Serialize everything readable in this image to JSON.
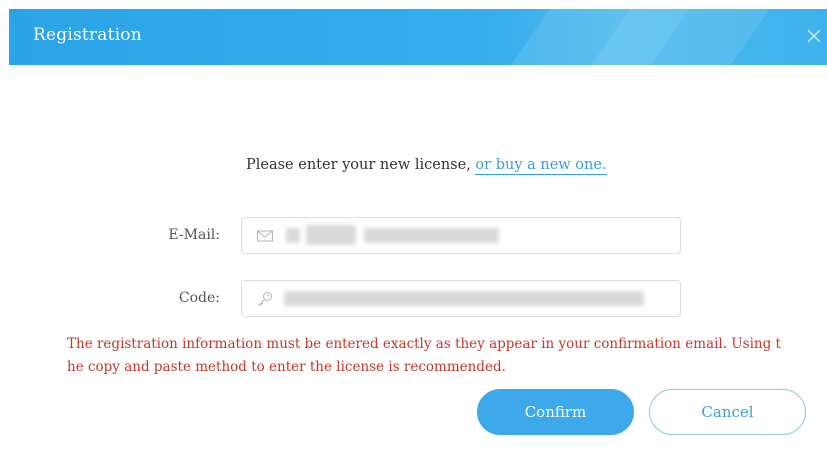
{
  "dialog": {
    "title": "Registration"
  },
  "prompt": {
    "text": "Please enter your new license, ",
    "buy_link": "or buy a new one."
  },
  "email": {
    "label": "E-Mail:",
    "icon": "mail-icon",
    "value_redacted": true
  },
  "code": {
    "label": "Code:",
    "icon": "key-icon",
    "value_redacted": true
  },
  "warning": {
    "text": "The registration information must be entered exactly as they appear in your confirmation email. Using t he copy and paste method to enter the license is recommended."
  },
  "buttons": {
    "confirm": "Confirm",
    "cancel": "Cancel"
  },
  "colors": {
    "accent": "#3da9ea",
    "link": "#3b9fd6",
    "warning": "#c0392b"
  }
}
